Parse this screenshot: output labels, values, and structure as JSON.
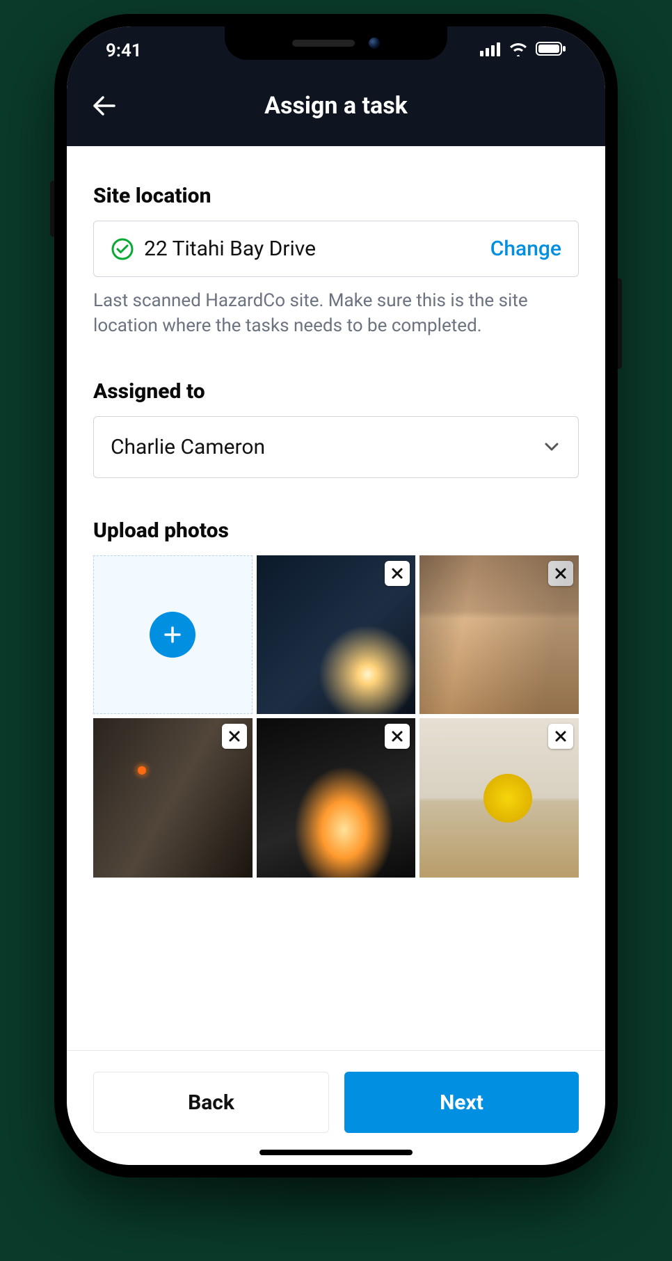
{
  "statusbar": {
    "time": "9:41"
  },
  "header": {
    "title": "Assign a task"
  },
  "site_location": {
    "label": "Site location",
    "value": "22 Titahi Bay Drive",
    "change_label": "Change",
    "helper": "Last scanned HazardCo site. Make sure this is the site location where the tasks needs to be completed."
  },
  "assigned_to": {
    "label": "Assigned to",
    "value": "Charlie Cameron"
  },
  "upload_photos": {
    "label": "Upload photos",
    "photos": [
      {
        "id": "welder-sparks"
      },
      {
        "id": "carpenter-lumber"
      },
      {
        "id": "rope-access-worker"
      },
      {
        "id": "angle-grinder-sparks"
      },
      {
        "id": "circular-saw-wood"
      }
    ]
  },
  "footer": {
    "back_label": "Back",
    "next_label": "Next"
  },
  "colors": {
    "primary": "#008fe1",
    "success": "#06a931",
    "header_bg": "#0e1521"
  }
}
